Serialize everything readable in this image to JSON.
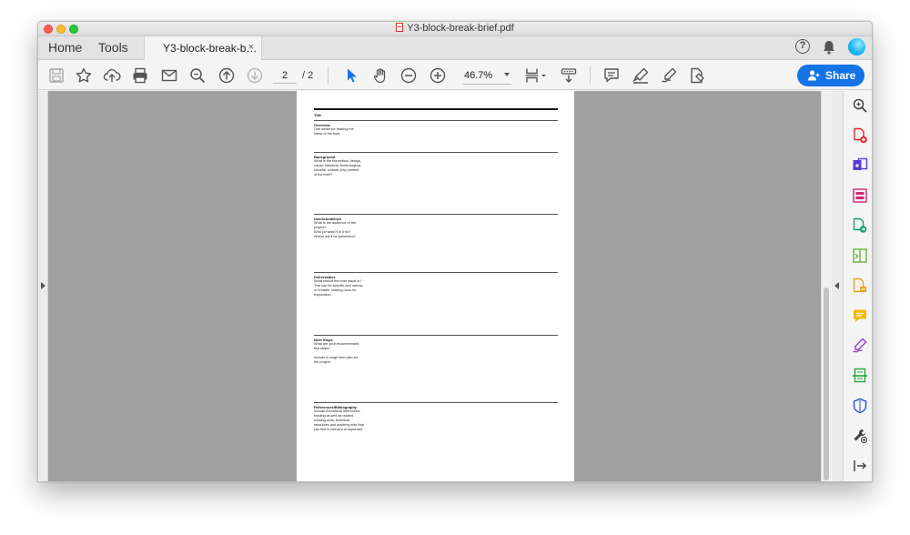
{
  "window": {
    "title": "Y3-block-break-brief.pdf"
  },
  "tabs": {
    "home": "Home",
    "tools": "Tools",
    "doc_tab": "Y3-block-break-b…",
    "close_glyph": "×"
  },
  "header": {
    "help_glyph": "?"
  },
  "toolbar": {
    "page_current": "2",
    "page_total": "/ 2",
    "zoom": "46.7%",
    "share_label": "Share"
  },
  "document": {
    "title": "Title",
    "sections": [
      {
        "heading": "Overview",
        "body": "One sentence framing the\nintent of the brief."
      },
      {
        "heading": "Background",
        "body": "What is the theoretical, design,\nvisual, historical, technological,\nsocietal, cultural (etc) content\nof the brief?"
      },
      {
        "heading": "Users/Audience",
        "body": "What is the audience of the\nproject?\nWho (or what?) is it for?\nWhere will it be presented?"
      },
      {
        "heading": "Deliverables",
        "body": "What should the brief result in?\nThis can be specific and narrow,\nor broader, leaving room for\nexploration."
      },
      {
        "heading": "Next Steps",
        "body": "What are your recommended\nfirst steps?\n\nInclude a rough time plan for\nthe project."
      },
      {
        "heading": "References/Bibliography",
        "body": "Include theoretical references/\nreading as well as related\nexisting work, technical\nresources and anything else that\nyou feel is relevant or important."
      }
    ]
  },
  "colors": {
    "accent": "#1473e6",
    "content_bg": "#a0a0a0"
  }
}
